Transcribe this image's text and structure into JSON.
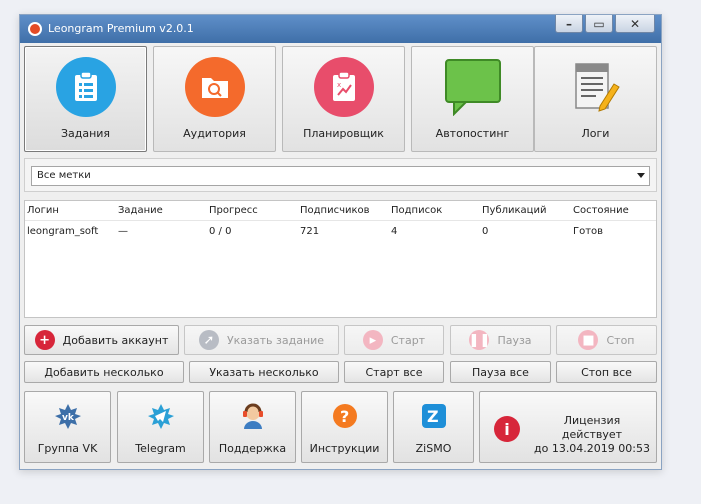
{
  "window": {
    "title": "Leongram Premium v2.0.1"
  },
  "window_controls": {
    "minimize": "–",
    "maximize": "▭",
    "close": "✕"
  },
  "modules": [
    {
      "label": "Задания",
      "color": "#29a3e3",
      "icon": "clipboard-list-icon"
    },
    {
      "label": "Аудитория",
      "color": "#f46a2c",
      "icon": "folder-search-icon"
    },
    {
      "label": "Планировщик",
      "color": "#e84d6b",
      "icon": "clipboard-plan-icon"
    },
    {
      "label": "Автопостинг",
      "color": "#6cc24a",
      "icon": "speech-bubble-icon"
    },
    {
      "label": "Логи",
      "color": "#888888",
      "icon": "log-document-icon"
    }
  ],
  "filter": {
    "value": "Все метки"
  },
  "table": {
    "columns": [
      "Логин",
      "Задание",
      "Прогресс",
      "Подписчиков",
      "Подписок",
      "Публикаций",
      "Состояние"
    ],
    "rows": [
      [
        "leongram_soft",
        "—",
        "0 / 0",
        "721",
        "4",
        "0",
        "Готов"
      ]
    ]
  },
  "actions": {
    "add_account": "Добавить аккаунт",
    "set_task": "Указать задание",
    "start": "Старт",
    "pause": "Пауза",
    "stop": "Стоп",
    "add_multiple": "Добавить несколько",
    "set_multiple": "Указать несколько",
    "start_all": "Старт все",
    "pause_all": "Пауза все",
    "stop_all": "Стоп все"
  },
  "links": [
    {
      "label": "Группа VK",
      "icon": "vk-icon"
    },
    {
      "label": "Telegram",
      "icon": "telegram-icon"
    },
    {
      "label": "Поддержка",
      "icon": "support-agent-icon"
    },
    {
      "label": "Инструкции",
      "icon": "help-question-icon"
    },
    {
      "label": "ZiSMO",
      "icon": "zismo-icon"
    }
  ],
  "license": {
    "line1": "Лицензия действует",
    "line2": "до 13.04.2019 00:53"
  }
}
